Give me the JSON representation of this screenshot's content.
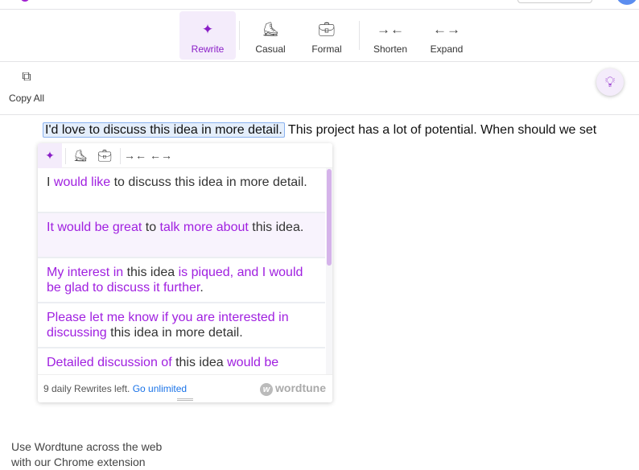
{
  "toolbar": {
    "items": [
      {
        "label": "Rewrite",
        "icon": "sparkles-icon",
        "active": true
      },
      {
        "label": "Casual",
        "icon": "sneaker-icon"
      },
      {
        "label": "Formal",
        "icon": "briefcase-icon"
      },
      {
        "label": "Shorten",
        "icon": "shorten-arrows-icon"
      },
      {
        "label": "Expand",
        "icon": "expand-arrows-icon"
      }
    ]
  },
  "copy_all": "Copy All",
  "document": {
    "selected": "I'd love to discuss this idea in more detail.",
    "rest": " This project has a lot of potential. When should we set"
  },
  "popup": {
    "suggestions": [
      [
        {
          "t": "I "
        },
        {
          "t": "would like",
          "h": 1
        },
        {
          "t": " to discuss this idea in more detail."
        }
      ],
      [
        {
          "t": "It would be great",
          "h": 1
        },
        {
          "t": " to "
        },
        {
          "t": "talk more about",
          "h": 1
        },
        {
          "t": " this idea."
        }
      ],
      [
        {
          "t": "My interest in",
          "h": 1
        },
        {
          "t": " this idea "
        },
        {
          "t": "is piqued, and I would be glad to discuss it further",
          "h": 1
        },
        {
          "t": "."
        }
      ],
      [
        {
          "t": "Please let me know if you are interested in discussing",
          "h": 1
        },
        {
          "t": " this idea in more detail."
        }
      ],
      [
        {
          "t": "Detailed discussion of",
          "h": 1
        },
        {
          "t": " this idea "
        },
        {
          "t": "would be",
          "h": 1
        }
      ]
    ],
    "footer_text": "9 daily Rewrites left.",
    "footer_link": "Go unlimited",
    "brand": "wordtune"
  },
  "promo": {
    "line1": "Use Wordtune across the web",
    "line2": "with our Chrome extension"
  },
  "colors": {
    "accent": "#8a1ec7",
    "highlight": "#a020e0",
    "link": "#1a73e8"
  }
}
